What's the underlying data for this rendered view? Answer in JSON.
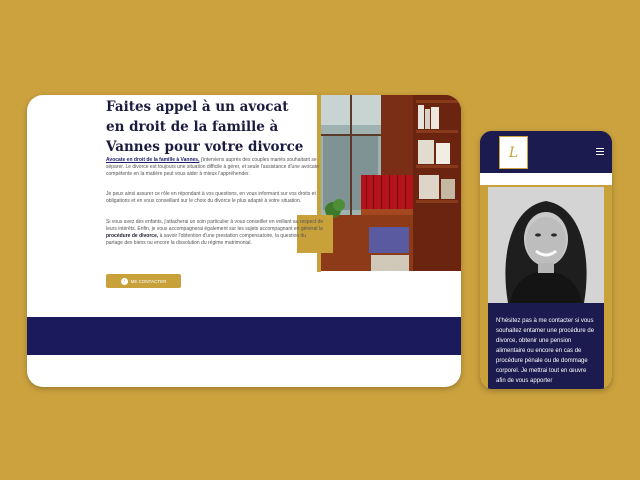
{
  "desktop": {
    "title": "Faites appel à un avocat en droit de la famille à Vannes pour votre divorce",
    "para1_link": "Avocate en droit de la famille à Vannes,",
    "para1_rest": " j'interviens auprès des couples mariés souhaitant se séparer. Le divorce est toujours une situation difficile à gérer, et seule l'assistance d'une avocate compétente en la matière peut vous aider à mieux l'appréhender.",
    "para2": "Je peux ainsi assurer ce rôle en répondant à vos questions, en vous informant sur vos droits et obligations et en vous conseillant sur le choix du divorce le plus adapté à votre situation.",
    "para3_a": "Si vous avez des enfants, j'attacherai un soin particulier à vous conseiller en veillant au respect de leurs intérêts. Enfin, je vous accompagnerai également sur les sujets accompagnant en général la ",
    "para3_bold": "procédure de divorce,",
    "para3_b": " à savoir l'obtention d'une prestation compensatoire, la question du partage des biens ou encore la dissolution du régime matrimonial.",
    "contact_button": "ME CONTACTER",
    "button_icon": "arrow-right-circle-icon"
  },
  "mobile": {
    "logo_text": "L",
    "menu_icon": "hamburger-menu-icon",
    "text": "N'hésitez pas à me contacter si vous souhaitez entamer une procédure de divorce, obtenir une pension alimentaire ou encore en cas de procédure pénale ou de dommage corporel. Je mettrai tout en œuvre afin de vous apporter"
  },
  "colors": {
    "background": "#cca23e",
    "accent_gold": "#c9a13b",
    "navy": "#1b1b4f",
    "title": "#1b1b3f"
  }
}
